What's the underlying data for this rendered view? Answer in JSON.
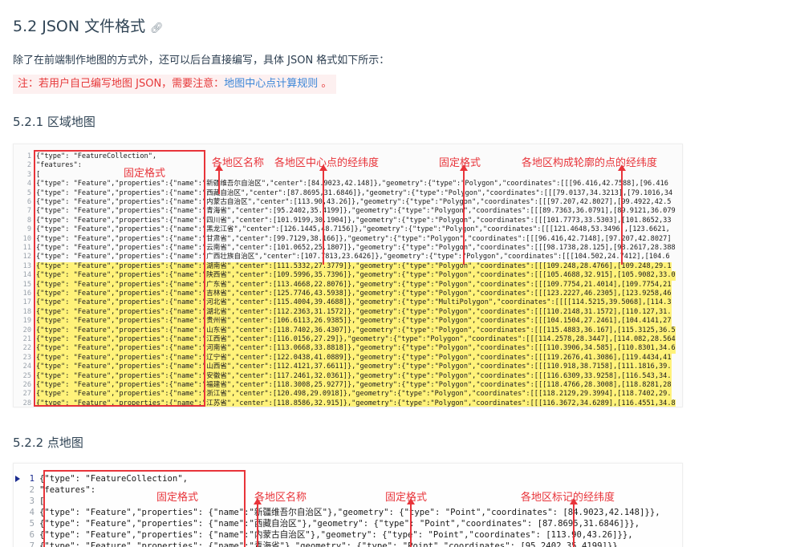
{
  "section_title": "5.2 JSON 文件格式",
  "link_icon": "link-icon",
  "intro": "除了在前端制作地图的方式外，还可以后台直接编写，具体 JSON 格式如下所示：",
  "notice": {
    "prefix": "注：若用户自己编写地图 JSON，需要注意：",
    "link": "地图中心点计算规则",
    "suffix": " 。"
  },
  "sub1_title": "5.2.1 区域地图",
  "sub2_title": "5.2.2 点地图",
  "region_annotations": {
    "fixed1": "固定格式",
    "name": "各地区名称",
    "center": "各地区中心点的经纬度",
    "fixed2": "固定格式",
    "outline": "各地区构成轮廓的点的经纬度"
  },
  "point_annotations": {
    "fixed1": "固定格式",
    "name": "各地区名称",
    "fixed2": "固定格式",
    "coords": "各地区标记的经纬度"
  },
  "region_code": [
    {
      "n": "1",
      "t": "{\"type\": \"FeatureCollection\",",
      "hl": false
    },
    {
      "n": "2",
      "t": "\"features\":",
      "hl": false
    },
    {
      "n": "3",
      "t": "[",
      "hl": false
    },
    {
      "n": "4",
      "t": "{\"type\": \"Feature\",\"properties\":{\"name\":\"新疆维吾尔自治区\",\"center\":[84.9023,42.148]},\"geometry\":{\"type\":\"Polygon\",\"coordinates\":[[[96.416,42.7588],[96.416",
      "hl": false
    },
    {
      "n": "5",
      "t": "{\"type\": \"Feature\",\"properties\":{\"name\":\"西藏自治区\",\"center\":[87.8695,31.6846]},\"geometry\":{\"type\":\"Polygon\",\"coordinates\":[[[79.0137,34.3213],[79.1016,34",
      "hl": false
    },
    {
      "n": "6",
      "t": "{\"type\": \"Feature\",\"properties\":{\"name\":\"内蒙古自治区\",\"center\":[113.90,43.26]},\"geometry\":{\"type\":\"Polygon\",\"coordinates\":[[[97.207,42.8027],[99.4922,42.5",
      "hl": false
    },
    {
      "n": "7",
      "t": "{\"type\": \"Feature\",\"properties\":{\"name\":\"青海省\",\"center\":[95.2402,35.4199]},\"geometry\":{\"type\":\"Polygon\",\"coordinates\":[[[89.7363,36.0791],[89.9121,36.079",
      "hl": false
    },
    {
      "n": "8",
      "t": "{\"type\": \"Feature\",\"properties\":{\"name\":\"四川省\",\"center\":[101.9199,30.1904]},\"geometry\":{\"type\":\"Polygon\",\"coordinates\":[[[101.7773,33.5303],[101.8652,33",
      "hl": false
    },
    {
      "n": "9",
      "t": "{\"type\": \"Feature\",\"properties\":{\"name\":\"黑龙江省\",\"center\":[126.1445,48.7156]},\"geometry\":{\"type\":\"Polygon\",\"coordinates\":[[[121.4648,53.3496],[123.6621,",
      "hl": false
    },
    {
      "n": "10",
      "t": "{\"type\": \"Feature\",\"properties\":{\"name\":\"甘肃省\",\"center\":[99.7129,38.166]},\"geometry\":{\"type\":\"Polygon\",\"coordinates\":[[[96.416,42.7148],[97.207,42.8027]",
      "hl": false
    },
    {
      "n": "11",
      "t": "{\"type\": \"Feature\",\"properties\":{\"name\":\"云南省\",\"center\":[101.0652,25.1807]},\"geometry\":{\"type\":\"Polygon\",\"coordinates\":[[[98.1738,28.125],[98.2617,28.388",
      "hl": false
    },
    {
      "n": "12",
      "t": "{\"type\": \"Feature\",\"properties\":{\"name\":\"广西壮族自治区\",\"center\":[107.7813,23.6426]},\"geometry\":{\"type\":\"Polygon\",\"coordinates\":[[[104.502,24.7412],[104.6",
      "hl": false
    },
    {
      "n": "13",
      "t": "{\"type\": \"Feature\",\"properties\":{\"name\":\"湖南省\",\"center\":[111.5332,27.3779]},\"geometry\":{\"type\":\"Polygon\",\"coordinates\":[[[109.248,28.4766],[109.248,29.1",
      "hl": true
    },
    {
      "n": "14",
      "t": "{\"type\": \"Feature\",\"properties\":{\"name\":\"陕西省\",\"center\":[109.5996,35.7396]},\"geometry\":{\"type\":\"Polygon\",\"coordinates\":[[[105.4688,32.915],[105.9082,33.0",
      "hl": true
    },
    {
      "n": "15",
      "t": "{\"type\": \"Feature\",\"properties\":{\"name\":\"广东省\",\"center\":[113.4668,22.8076]},\"geometry\":{\"type\":\"Polygon\",\"coordinates\":[[[109.7754,21.4014],[109.7754,21",
      "hl": true
    },
    {
      "n": "16",
      "t": "{\"type\": \"Feature\",\"properties\":{\"name\":\"吉林省\",\"center\":[125.7746,43.5938]},\"geometry\":{\"type\":\"Polygon\",\"coordinates\":[[[123.2227,46.2305],[123.9258,46",
      "hl": true
    },
    {
      "n": "17",
      "t": "{\"type\": \"Feature\",\"properties\":{\"name\":\"河北省\",\"center\":[115.4004,39.4688]},\"geometry\":{\"type\":\"MultiPolygon\",\"coordinates\":[[[[114.5215,39.5068],[114.3",
      "hl": true
    },
    {
      "n": "18",
      "t": "{\"type\": \"Feature\",\"properties\":{\"name\":\"湖北省\",\"center\":[112.2363,31.1572]},\"geometry\":{\"type\":\"Polygon\",\"coordinates\":[[[110.2148,31.1572],[110.127,31.",
      "hl": true
    },
    {
      "n": "19",
      "t": "{\"type\": \"Feature\",\"properties\":{\"name\":\"贵州省\",\"center\":[106.6113,26.9385]},\"geometry\":{\"type\":\"Polygon\",\"coordinates\":[[[104.1504,27.2461],[104.4141,27",
      "hl": true
    },
    {
      "n": "20",
      "t": "{\"type\": \"Feature\",\"properties\":{\"name\":\"山东省\",\"center\":[118.7402,36.4307]},\"geometry\":{\"type\":\"Polygon\",\"coordinates\":[[[115.4883,36.167],[115.3125,36.5",
      "hl": true
    },
    {
      "n": "21",
      "t": "{\"type\": \"Feature\",\"properties\":{\"name\":\"江西省\",\"center\":[116.0156,27.29]},\"geometry\":{\"type\":\"Polygon\",\"coordinates\":[[[114.2578,28.3447],[114.082,28.564",
      "hl": true
    },
    {
      "n": "22",
      "t": "{\"type\": \"Feature\",\"properties\":{\"name\":\"河南省\",\"center\":[113.0668,33.8818]},\"geometry\":{\"type\":\"Polygon\",\"coordinates\":[[[110.3906,34.585],[110.8301,34.6",
      "hl": true
    },
    {
      "n": "23",
      "t": "{\"type\": \"Feature\",\"properties\":{\"name\":\"辽宁省\",\"center\":[122.0438,41.0889]},\"geometry\":{\"type\":\"Polygon\",\"coordinates\":[[[119.2676,41.3086],[119.4434,41",
      "hl": true
    },
    {
      "n": "24",
      "t": "{\"type\": \"Feature\",\"properties\":{\"name\":\"山西省\",\"center\":[112.4121,37.6611]},\"geometry\":{\"type\":\"Polygon\",\"coordinates\":[[[110.918,38.7158],[111.1816,39.",
      "hl": true
    },
    {
      "n": "25",
      "t": "{\"type\": \"Feature\",\"properties\":{\"name\":\"安徽省\",\"center\":[117.2461,32.0361]},\"geometry\":{\"type\":\"Polygon\",\"coordinates\":[[[116.6309,33.9258],[116.543,34.",
      "hl": true
    },
    {
      "n": "26",
      "t": "{\"type\": \"Feature\",\"properties\":{\"name\":\"福建省\",\"center\":[118.3008,25.9277]},\"geometry\":{\"type\":\"Polygon\",\"coordinates\":[[[118.4766,28.3008],[118.8281,28",
      "hl": true
    },
    {
      "n": "27",
      "t": "{\"type\": \"Feature\",\"properties\":{\"name\":\"浙江省\",\"center\":[120.498,29.0918]},\"geometry\":{\"type\":\"Polygon\",\"coordinates\":[[[118.2129,29.3994],[118.7402,29.",
      "hl": true
    },
    {
      "n": "28",
      "t": "{\"type\": \"Feature\",\"properties\":{\"name\":\"江苏省\",\"center\":[118.8586,32.915]},\"geometry\":{\"type\":\"Polygon\",\"coordinates\":[[[116.3672,34.6289],[116.4551,34.8",
      "hl": true
    }
  ],
  "point_code": [
    {
      "n": "1",
      "t": "{\"type\": \"FeatureCollection\","
    },
    {
      "n": "2",
      "t": "\"features\":"
    },
    {
      "n": "3",
      "t": "["
    },
    {
      "n": "4",
      "t": "{\"type\": \"Feature\",\"properties\": {\"name\":\"新疆维吾尔自治区\"},\"geometry\": {\"type\": \"Point\",\"coordinates\": [84.9023,42.148]}},"
    },
    {
      "n": "5",
      "t": "{\"type\": \"Feature\",\"properties\": {\"name\":\"西藏自治区\"},\"geometry\": {\"type\": \"Point\",\"coordinates\": [87.8695,31.6846]}},"
    },
    {
      "n": "6",
      "t": "{\"type\": \"Feature\",\"properties\": {\"name\":\"内蒙古自治区\"},\"geometry\": {\"type\": \"Point\",\"coordinates\": [113.90,43.26]}},"
    },
    {
      "n": "7",
      "t": "{\"type\": \"Feature\",\"properties\": {\"name\":\"青海省\"},\"geometry\": {\"type\": \"Point\",\"coordinates\": [95.2402,35.4199]}},"
    }
  ]
}
